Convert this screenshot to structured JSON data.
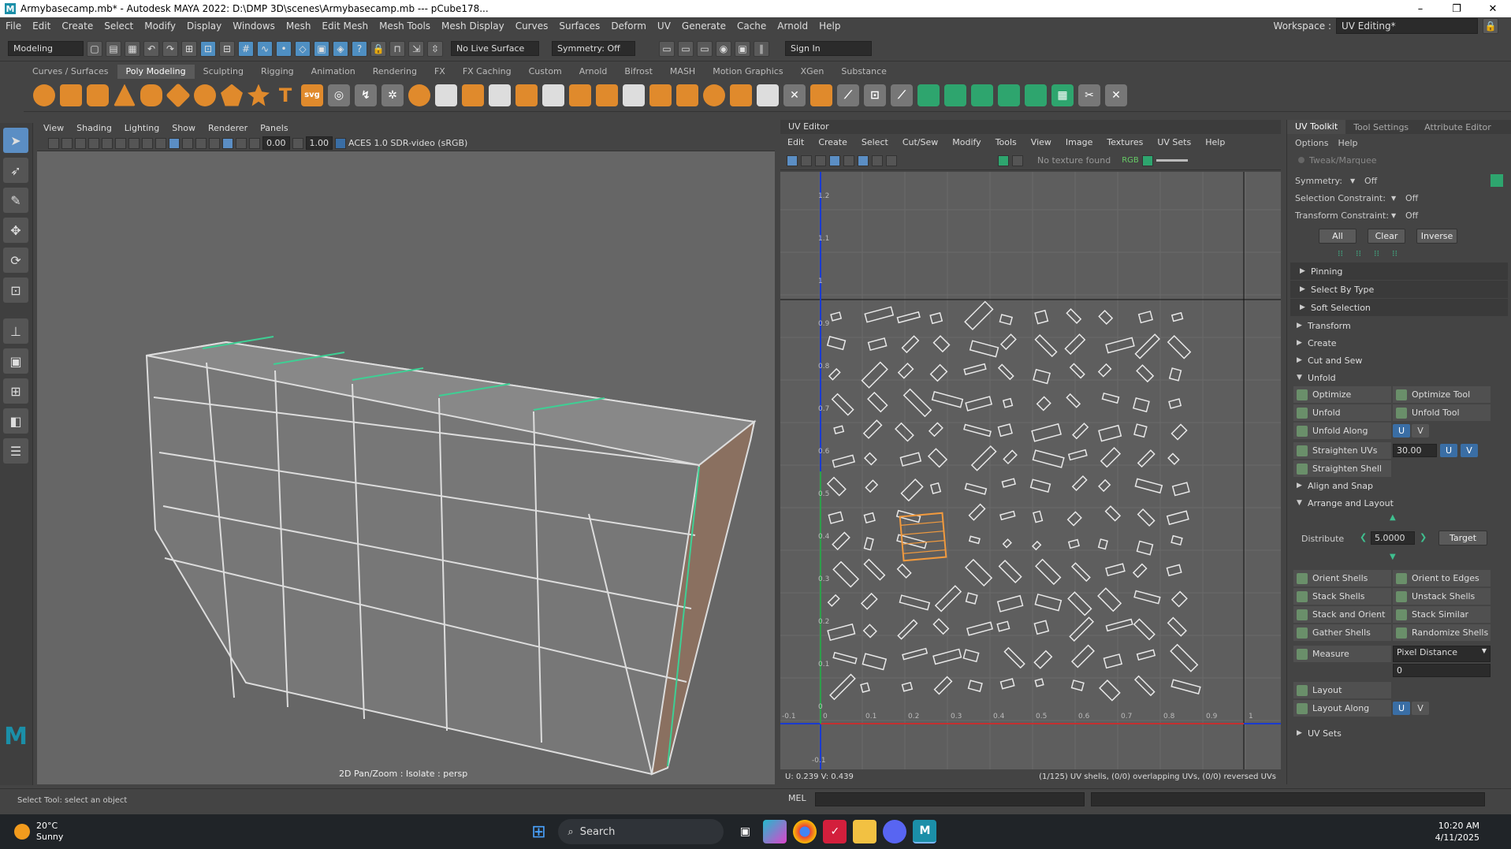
{
  "titlebar": {
    "title": "Armybasecamp.mb* - Autodesk MAYA 2022: D:\\DMP 3D\\scenes\\Armybasecamp.mb   ---   pCube178...",
    "minimize": "–",
    "maximize": "❐",
    "close": "✕"
  },
  "menu": {
    "items": [
      "File",
      "Edit",
      "Create",
      "Select",
      "Modify",
      "Display",
      "Windows",
      "Mesh",
      "Edit Mesh",
      "Mesh Tools",
      "Mesh Display",
      "Curves",
      "Surfaces",
      "Deform",
      "UV",
      "Generate",
      "Cache",
      "Arnold",
      "Help"
    ],
    "workspace_label": "Workspace :",
    "workspace_value": "UV Editing*"
  },
  "statusline": {
    "mode": "Modeling",
    "live_surface": "No Live Surface",
    "symmetry": "Symmetry: Off",
    "sign_in": "Sign In"
  },
  "shelf": {
    "tabs": [
      "Curves / Surfaces",
      "Poly Modeling",
      "Sculpting",
      "Rigging",
      "Animation",
      "Rendering",
      "FX",
      "FX Caching",
      "Custom",
      "Arnold",
      "Bifrost",
      "MASH",
      "Motion Graphics",
      "XGen",
      "Substance"
    ],
    "active_tab": "Poly Modeling",
    "text_icon": "T",
    "svg_icon": "svg"
  },
  "viewport": {
    "menu": [
      "View",
      "Shading",
      "Lighting",
      "Show",
      "Renderer",
      "Panels"
    ],
    "exposure": "0.00",
    "gamma": "1.00",
    "color_space": "ACES 1.0 SDR-video (sRGB)",
    "label": "2D Pan/Zoom : Isolate : persp"
  },
  "uv_editor": {
    "header": "UV Editor",
    "menu": [
      "Edit",
      "Create",
      "Select",
      "Cut/Sew",
      "Modify",
      "Tools",
      "View",
      "Image",
      "Textures",
      "UV Sets",
      "Help"
    ],
    "texture_status": "No texture found",
    "rgb_label": "RGB",
    "status_left": "U:  0.239  V:  0.439",
    "status_right": "(1/125) UV shells, (0/0) overlapping UVs, (0/0) reversed UVs",
    "u_ticks": [
      "-0.1",
      "0",
      "0.1",
      "0.2",
      "0.3",
      "0.4",
      "0.5",
      "0.6",
      "0.7",
      "0.8",
      "0.9",
      "1"
    ],
    "v_ticks": [
      "1.2",
      "1.1",
      "1",
      "0.9",
      "0.8",
      "0.7",
      "0.6",
      "0.5",
      "0.4",
      "0.3",
      "0.2",
      "0.1",
      "0",
      "-0.1"
    ]
  },
  "uv_toolkit": {
    "tabs": [
      "UV Toolkit",
      "Tool Settings",
      "Attribute Editor"
    ],
    "options": "Options",
    "help": "Help",
    "tweak": "Tweak/Marquee",
    "symmetry_label": "Symmetry:",
    "symmetry_value": "Off",
    "sel_constraint_label": "Selection Constraint:",
    "sel_constraint_value": "Off",
    "trans_constraint_label": "Transform Constraint:",
    "trans_constraint_value": "Off",
    "all": "All",
    "clear": "Clear",
    "inverse": "Inverse",
    "subsections": [
      "Pinning",
      "Select By Type",
      "Soft Selection"
    ],
    "sections": [
      "Transform",
      "Create",
      "Cut and Sew"
    ],
    "unfold_title": "Unfold",
    "unfold_grid": [
      "Optimize",
      "Optimize Tool",
      "Unfold",
      "Unfold Tool"
    ],
    "unfold_along": "Unfold Along",
    "straighten_uvs": "Straighten UVs",
    "straighten_value": "30.00",
    "straighten_shell": "Straighten Shell",
    "u": "U",
    "v": "V",
    "align_snap": "Align and Snap",
    "arrange_title": "Arrange and Layout",
    "distribute_label": "Distribute",
    "distribute_value": "5.0000",
    "target": "Target",
    "arrange_grid": [
      "Orient Shells",
      "Orient to Edges",
      "Stack Shells",
      "Unstack Shells",
      "Stack and Orient",
      "Stack Similar",
      "Gather Shells",
      "Randomize Shells"
    ],
    "measure": "Measure",
    "measure_mode": "Pixel Distance",
    "measure_value": "0",
    "layout": "Layout",
    "layout_along": "Layout Along",
    "uv_sets": "UV Sets"
  },
  "bottom": {
    "help": "Select Tool: select an object",
    "mel": "MEL"
  },
  "taskbar": {
    "temp": "20°C",
    "weather": "Sunny",
    "search": "Search",
    "time": "10:20 AM",
    "date": "4/11/2025"
  }
}
